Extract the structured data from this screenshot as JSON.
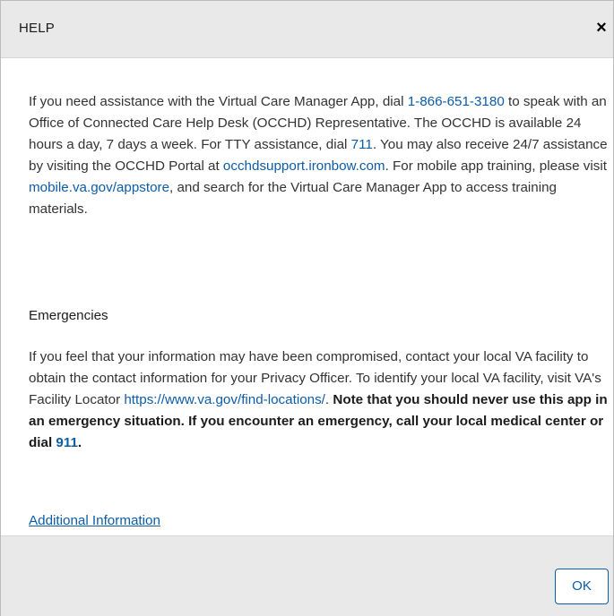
{
  "dialog": {
    "title": "HELP",
    "close_glyph": "×",
    "close_icon": "close-icon"
  },
  "help": {
    "t1": "If you need assistance with the Virtual Care Manager App, dial ",
    "phone": "1-866-651-3180",
    "t2": " to speak with an Office of Connected Care Help Desk (OCCHD) Representative. The OCCHD is available 24 hours a day, 7 days a week. For TTY assistance, dial ",
    "tty": "711",
    "t3": ". You may also receive 24/7 assistance by visiting the OCCHD Portal at ",
    "portal": "occhdsupport.ironbow.com",
    "t4": ". For mobile app training, please visit ",
    "appstore": "mobile.va.gov/appstore",
    "t5": ", and search for the Virtual Care Manager App to access training materials."
  },
  "emergencies": {
    "heading": "Emergencies",
    "t1": "If you feel that your information may have been compromised, contact your local VA facility to obtain the contact information for your Privacy Officer. To identify your local VA facility, visit VA's Facility Locator ",
    "locator": "https://www.va.gov/find-locations/",
    "t2": ". ",
    "bold": "Note that you should never use this app in an emergency situation. If you encounter an emergency, call your local medical center or dial ",
    "emergency_number": "911",
    "bold_end": "."
  },
  "links": {
    "additional_info": "Additional Information"
  },
  "footer": {
    "ok_label": "OK"
  },
  "colors": {
    "link": "#0d5ca8",
    "header_bg": "#e9e9e9",
    "text": "#333333"
  }
}
